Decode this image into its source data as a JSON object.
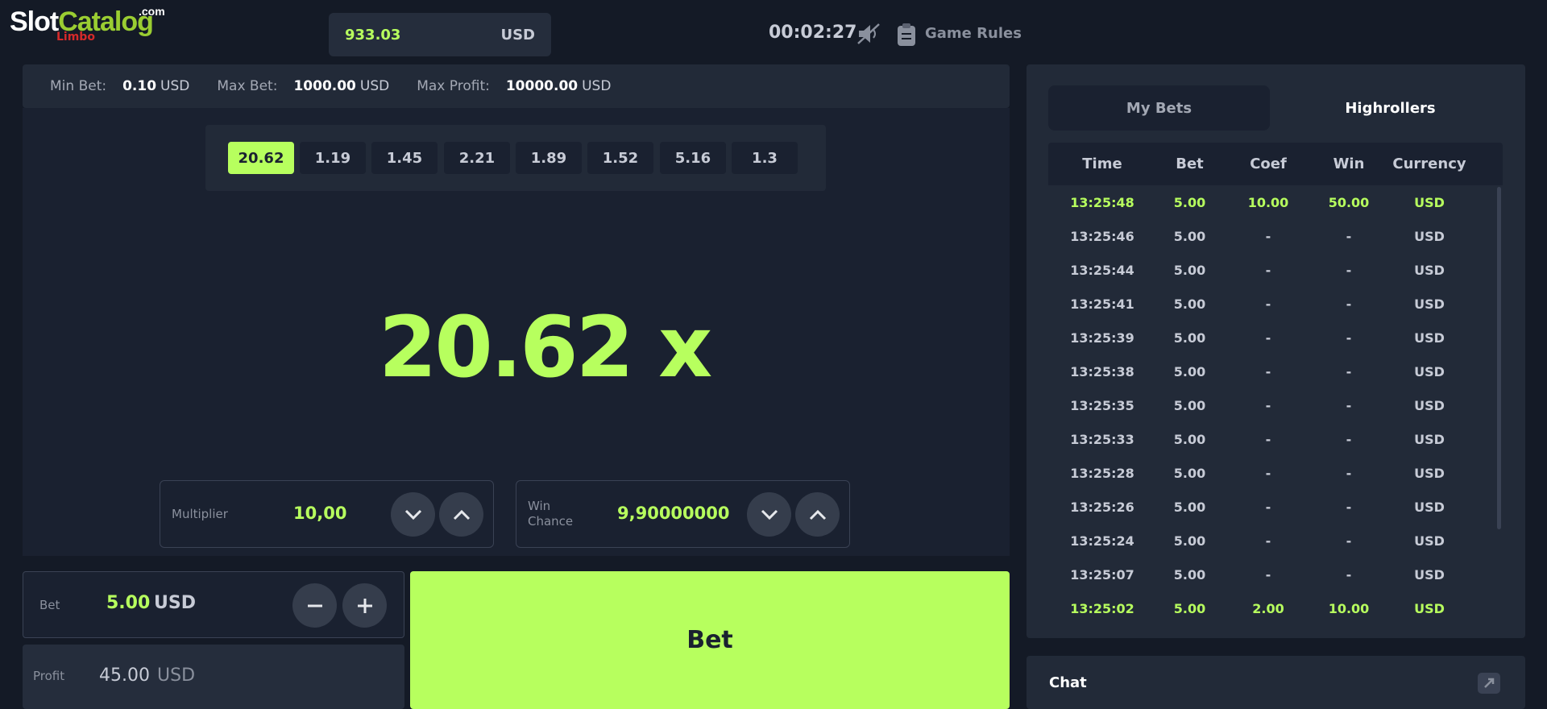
{
  "logo": {
    "slot": "Slot",
    "catalog": "Catalog",
    "com": ".com",
    "game": "Limbo"
  },
  "header": {
    "balance_amount": "933.03",
    "balance_currency": "USD",
    "timer": "00:02:27",
    "game_rules_label": "Game Rules",
    "icons": [
      "sound-muted-icon",
      "clipboard-icon"
    ]
  },
  "limits": {
    "min_label": "Min Bet:",
    "min_value": "0.10",
    "min_currency": "USD",
    "max_label": "Max Bet:",
    "max_value": "1000.00",
    "max_currency": "USD",
    "profit_label": "Max Profit:",
    "profit_value": "10000.00",
    "profit_currency": "USD"
  },
  "history": [
    "20.62",
    "1.19",
    "1.45",
    "2.21",
    "1.89",
    "1.52",
    "5.16",
    "1.3"
  ],
  "result_multiplier": "20.62 x",
  "multiplier_control": {
    "label": "Multiplier",
    "value": "10,00"
  },
  "win_chance_control": {
    "label_line1": "Win",
    "label_line2": "Chance",
    "value": "9,90000000"
  },
  "bet": {
    "label": "Bet",
    "value": "5.00",
    "currency": "USD"
  },
  "profit": {
    "label": "Profit",
    "value": "45.00",
    "currency": "USD"
  },
  "bet_button_label": "Bet",
  "panel": {
    "tabs": [
      "My Bets",
      "Highrollers"
    ],
    "active_tab": "Highrollers",
    "columns": [
      "Time",
      "Bet",
      "Coef",
      "Win",
      "Currency"
    ],
    "rows": [
      {
        "time": "13:25:48",
        "bet": "5.00",
        "coef": "10.00",
        "win": "50.00",
        "currency": "USD",
        "is_win": true
      },
      {
        "time": "13:25:46",
        "bet": "5.00",
        "coef": "-",
        "win": "-",
        "currency": "USD",
        "is_win": false
      },
      {
        "time": "13:25:44",
        "bet": "5.00",
        "coef": "-",
        "win": "-",
        "currency": "USD",
        "is_win": false
      },
      {
        "time": "13:25:41",
        "bet": "5.00",
        "coef": "-",
        "win": "-",
        "currency": "USD",
        "is_win": false
      },
      {
        "time": "13:25:39",
        "bet": "5.00",
        "coef": "-",
        "win": "-",
        "currency": "USD",
        "is_win": false
      },
      {
        "time": "13:25:38",
        "bet": "5.00",
        "coef": "-",
        "win": "-",
        "currency": "USD",
        "is_win": false
      },
      {
        "time": "13:25:35",
        "bet": "5.00",
        "coef": "-",
        "win": "-",
        "currency": "USD",
        "is_win": false
      },
      {
        "time": "13:25:33",
        "bet": "5.00",
        "coef": "-",
        "win": "-",
        "currency": "USD",
        "is_win": false
      },
      {
        "time": "13:25:28",
        "bet": "5.00",
        "coef": "-",
        "win": "-",
        "currency": "USD",
        "is_win": false
      },
      {
        "time": "13:25:26",
        "bet": "5.00",
        "coef": "-",
        "win": "-",
        "currency": "USD",
        "is_win": false
      },
      {
        "time": "13:25:24",
        "bet": "5.00",
        "coef": "-",
        "win": "-",
        "currency": "USD",
        "is_win": false
      },
      {
        "time": "13:25:07",
        "bet": "5.00",
        "coef": "-",
        "win": "-",
        "currency": "USD",
        "is_win": false
      },
      {
        "time": "13:25:02",
        "bet": "5.00",
        "coef": "2.00",
        "win": "10.00",
        "currency": "USD",
        "is_win": true
      }
    ]
  },
  "chat": {
    "label": "Chat"
  },
  "colors": {
    "accent": "#b7ff5e",
    "background": "#141a26",
    "panel": "#222a38"
  }
}
